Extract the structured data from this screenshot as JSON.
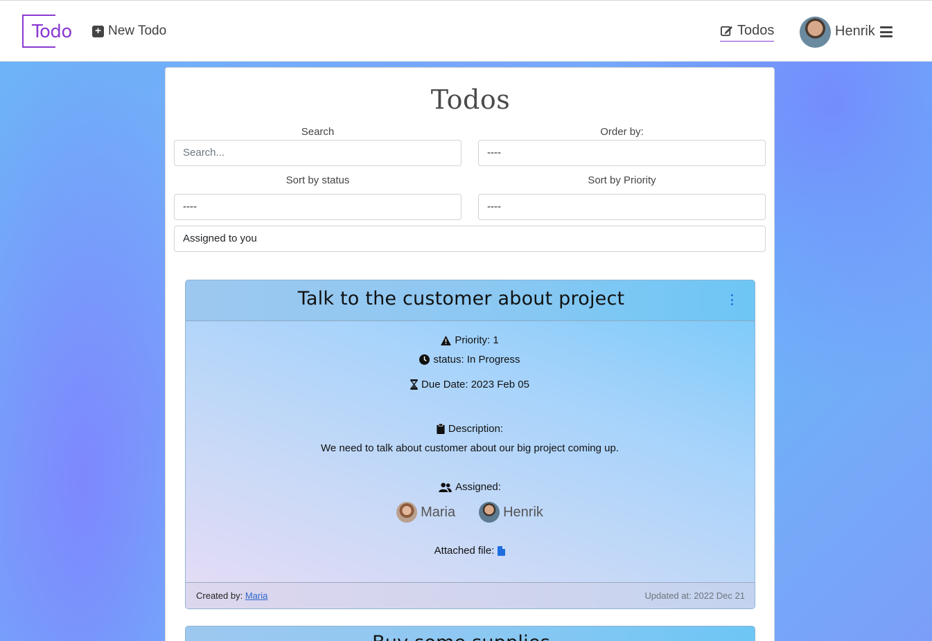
{
  "nav": {
    "brand": "Todo",
    "new_todo": "New Todo",
    "todos": "Todos",
    "user_name": "Henrik"
  },
  "filters": {
    "title": "Todos",
    "search_label": "Search",
    "search_placeholder": "Search...",
    "order_label": "Order by:",
    "order_value": "----",
    "status_label": "Sort by status",
    "status_value": "----",
    "priority_label": "Sort by Priority",
    "priority_value": "----",
    "assigned_value": "Assigned to you"
  },
  "todos": [
    {
      "title": "Talk to the customer about project",
      "priority": "Priority: 1",
      "status": "status: In Progress",
      "due": "Due Date: 2023 Feb 05",
      "description_label": "Description:",
      "description": "We need to talk about customer about our big project coming up.",
      "assigned_label": "Assigned:",
      "assignees": [
        "Maria",
        "Henrik"
      ],
      "attached_label": "Attached file:",
      "created_label": "Created by:",
      "created_by": "Maria",
      "updated": "Updated at: 2022 Dec 21"
    },
    {
      "title": "Buy some supplies"
    }
  ],
  "colors": {
    "brand": "#8a39d2",
    "link": "#2a65c8",
    "kebab": "#2a6fd8"
  },
  "icons": [
    "plus-square-icon",
    "edit-icon",
    "menu-icon",
    "warning-icon",
    "clock-icon",
    "hourglass-icon",
    "clipboard-icon",
    "users-icon",
    "file-icon",
    "kebab-icon"
  ]
}
